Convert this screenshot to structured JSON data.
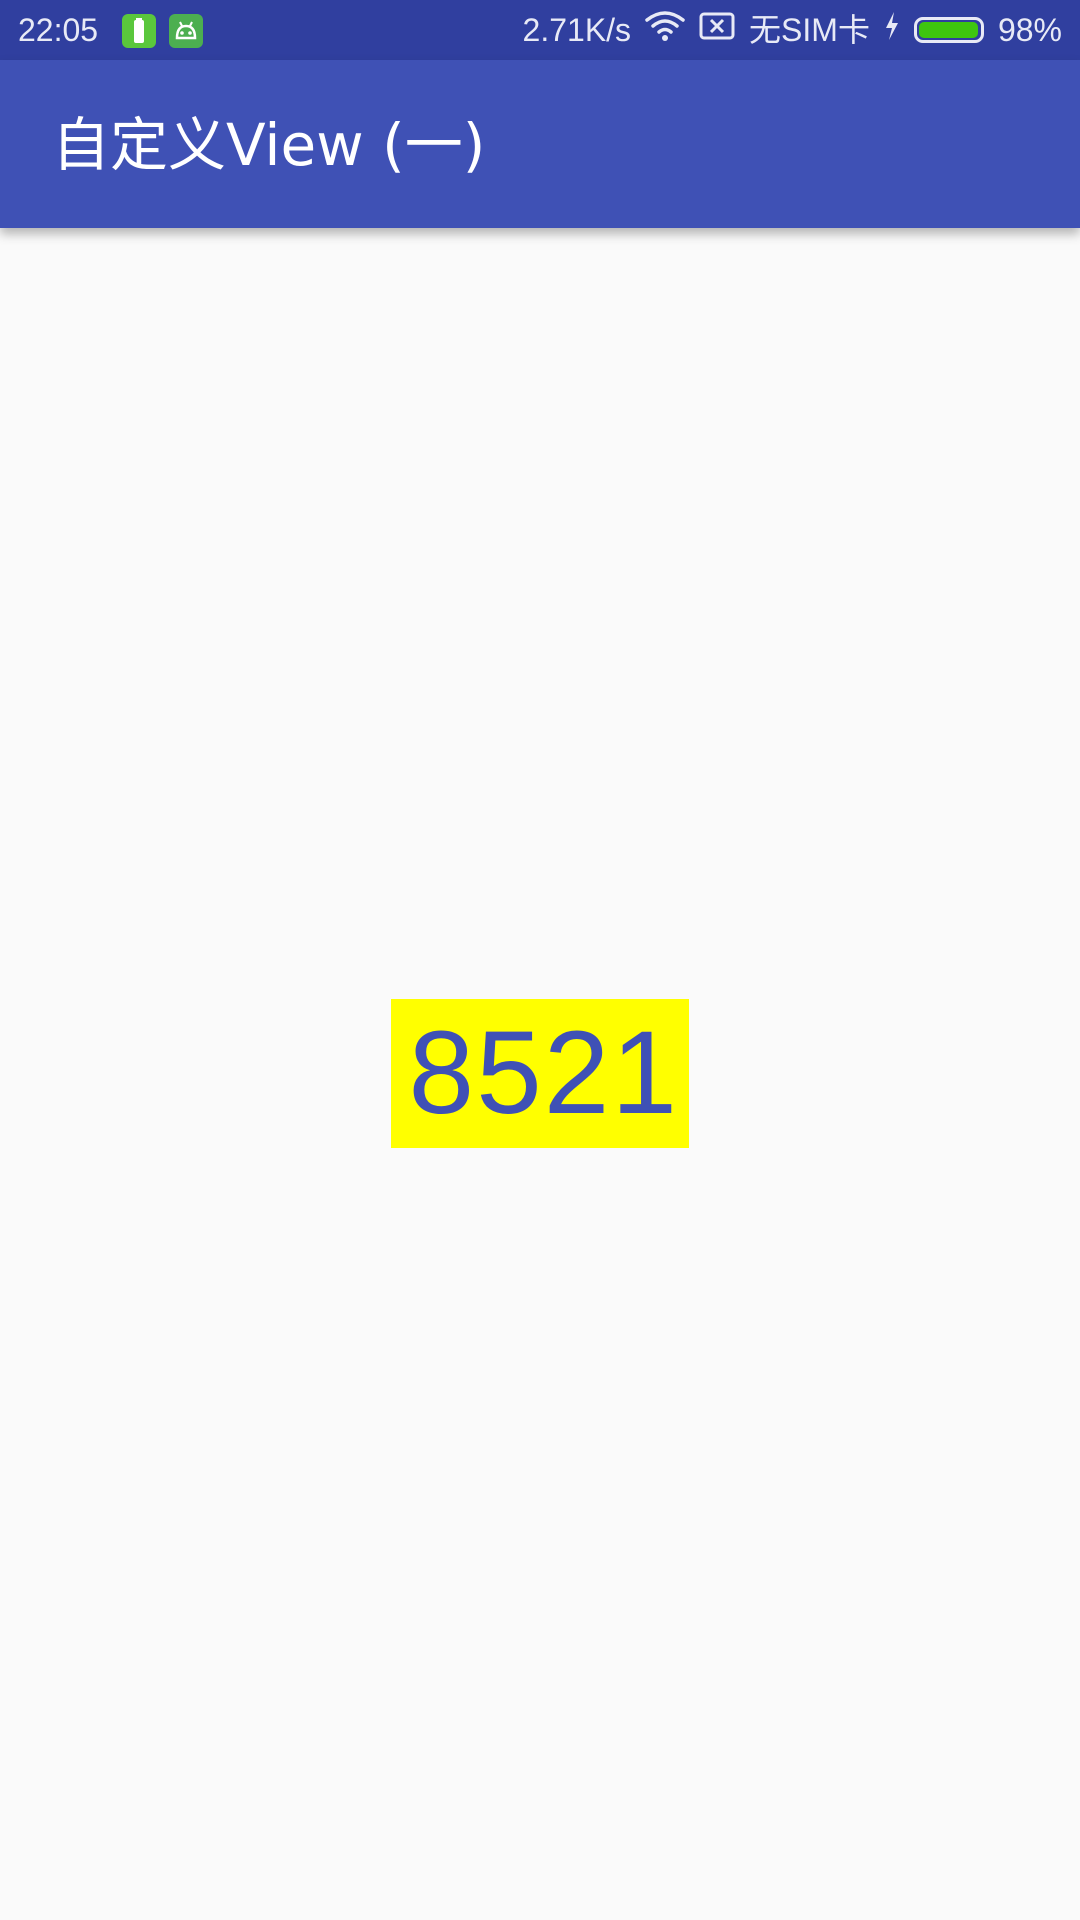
{
  "status_bar": {
    "time": "22:05",
    "network_speed": "2.71K/s",
    "sim_status": "无SIM卡",
    "battery_percent": "98%",
    "battery_level": 0.98,
    "icons": [
      "battery-app-icon",
      "android-app-icon",
      "wifi-icon",
      "no-sim-icon",
      "charging-icon",
      "battery-icon"
    ]
  },
  "app_bar": {
    "title": "自定义View (一)"
  },
  "counter": {
    "value": "8521"
  },
  "colors": {
    "primary": "#3f51b5",
    "primary_dark": "#303f9f",
    "background": "#fafafa",
    "counter_background": "#ffff00",
    "battery_fill": "#3ec60f"
  }
}
